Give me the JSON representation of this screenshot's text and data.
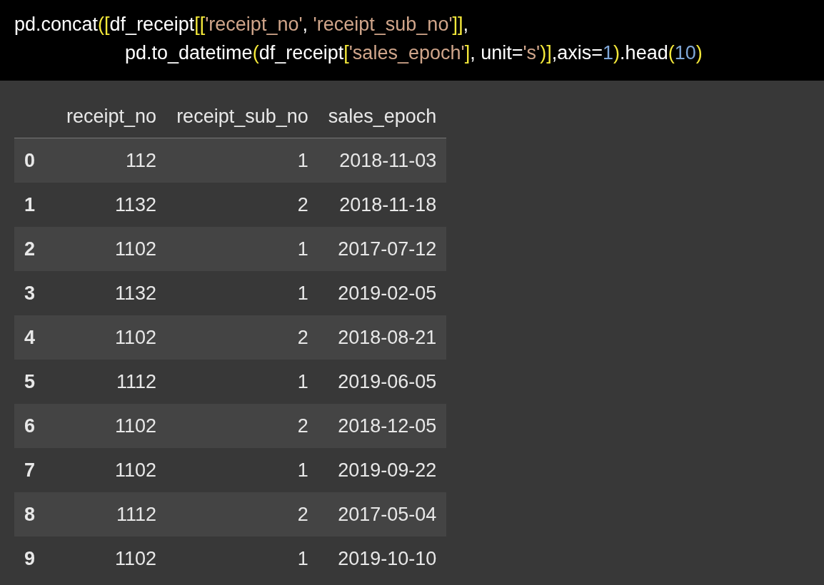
{
  "code": {
    "lines": [
      {
        "indented": false,
        "tokens": [
          {
            "kind": "plain",
            "text": "pd.concat"
          },
          {
            "kind": "bracket",
            "text": "(["
          },
          {
            "kind": "plain",
            "text": "df_receipt"
          },
          {
            "kind": "bracket",
            "text": "[["
          },
          {
            "kind": "string",
            "text": "'receipt_no'"
          },
          {
            "kind": "plain",
            "text": ", "
          },
          {
            "kind": "string",
            "text": "'receipt_sub_no'"
          },
          {
            "kind": "bracket",
            "text": "]]"
          },
          {
            "kind": "plain",
            "text": ","
          }
        ]
      },
      {
        "indented": true,
        "tokens": [
          {
            "kind": "plain",
            "text": "pd.to_datetime"
          },
          {
            "kind": "bracket",
            "text": "("
          },
          {
            "kind": "plain",
            "text": "df_receipt"
          },
          {
            "kind": "bracket",
            "text": "["
          },
          {
            "kind": "string",
            "text": "'sales_epoch'"
          },
          {
            "kind": "bracket",
            "text": "]"
          },
          {
            "kind": "plain",
            "text": ", unit="
          },
          {
            "kind": "string",
            "text": "'s'"
          },
          {
            "kind": "bracket",
            "text": ")]"
          },
          {
            "kind": "plain",
            "text": ",axis="
          },
          {
            "kind": "number",
            "text": "1"
          },
          {
            "kind": "bracket",
            "text": ")"
          },
          {
            "kind": "plain",
            "text": ".head"
          },
          {
            "kind": "bracket",
            "text": "("
          },
          {
            "kind": "number",
            "text": "10"
          },
          {
            "kind": "bracket",
            "text": ")"
          }
        ]
      }
    ]
  },
  "table": {
    "columns": [
      "receipt_no",
      "receipt_sub_no",
      "sales_epoch"
    ],
    "rows": [
      {
        "index": "0",
        "cells": [
          "112",
          "1",
          "2018-11-03"
        ]
      },
      {
        "index": "1",
        "cells": [
          "1132",
          "2",
          "2018-11-18"
        ]
      },
      {
        "index": "2",
        "cells": [
          "1102",
          "1",
          "2017-07-12"
        ]
      },
      {
        "index": "3",
        "cells": [
          "1132",
          "1",
          "2019-02-05"
        ]
      },
      {
        "index": "4",
        "cells": [
          "1102",
          "2",
          "2018-08-21"
        ]
      },
      {
        "index": "5",
        "cells": [
          "1112",
          "1",
          "2019-06-05"
        ]
      },
      {
        "index": "6",
        "cells": [
          "1102",
          "2",
          "2018-12-05"
        ]
      },
      {
        "index": "7",
        "cells": [
          "1102",
          "1",
          "2019-09-22"
        ]
      },
      {
        "index": "8",
        "cells": [
          "1112",
          "2",
          "2017-05-04"
        ]
      },
      {
        "index": "9",
        "cells": [
          "1102",
          "1",
          "2019-10-10"
        ]
      }
    ]
  }
}
